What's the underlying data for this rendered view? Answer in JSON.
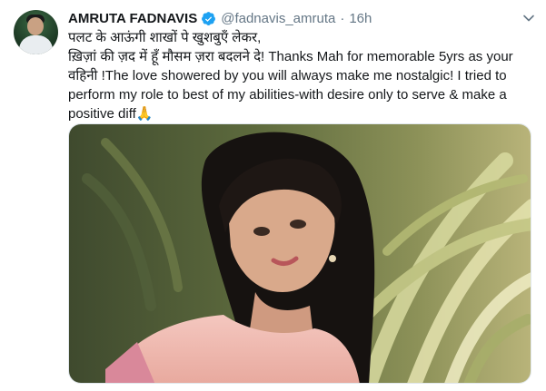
{
  "tweet": {
    "author_name": "AMRUTA FADNAVIS",
    "verified_icon": "verified-badge-icon",
    "handle": "@fadnavis_amruta",
    "separator": "·",
    "time": "16h",
    "text": "पलट के आऊंगी शाखों पे खुशबुएँ लेकर,\nख़िज़ां की ज़द में हूँ मौसम ज़रा बदलने दे! Thanks Mah for memorable 5yrs as your वहिनी !The love showered by you will always make me nostalgic! I tried to perform my role to best of my abilities-with desire only to serve & make a positive diff🙏",
    "more_icon": "chevron-down-icon",
    "media_type": "photo"
  },
  "colors": {
    "text": "#14171a",
    "secondary": "#657786",
    "verified": "#1da1f2",
    "border": "#e1e8ed"
  }
}
